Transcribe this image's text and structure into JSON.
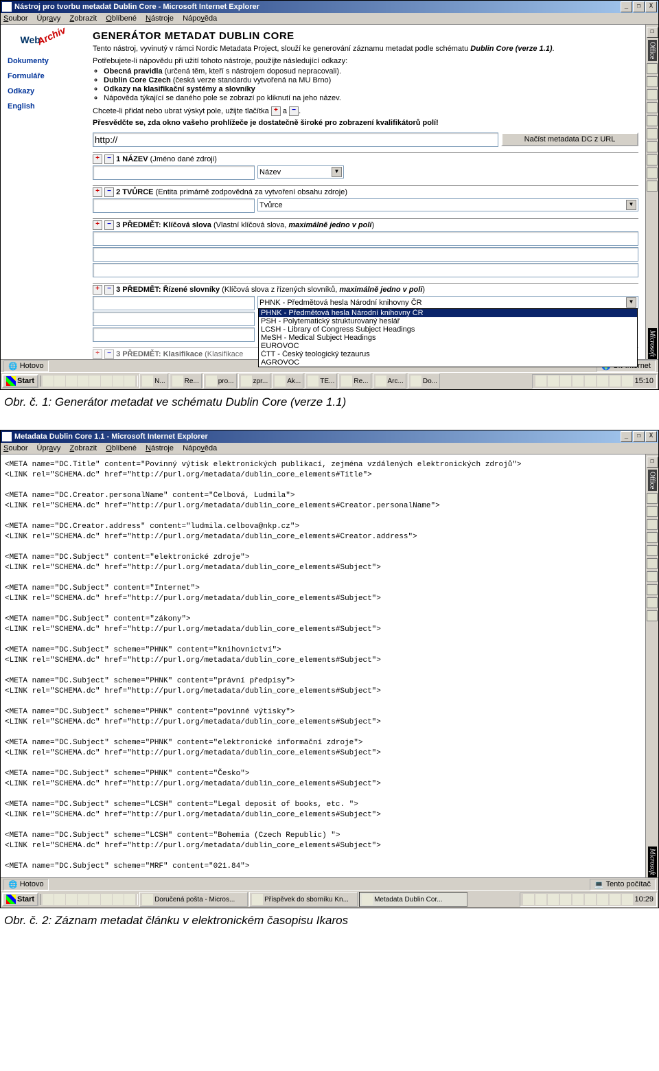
{
  "fig1": {
    "titlebar": "Nástroj pro tvorbu metadat Dublin Core - Microsoft Internet Explorer",
    "menus": [
      "Soubor",
      "Úpravy",
      "Zobrazit",
      "Oblíbené",
      "Nástroje",
      "Nápověda"
    ],
    "logo_web": "Web",
    "logo_archiv": "Archiv",
    "page_title": "GENERÁTOR METADAT DUBLIN CORE",
    "intro1": "Tento nástroj, vyvinutý v rámci Nordic Metadata Project, slouží ke generování záznamu metadat podle schématu ",
    "intro2_bold": "Dublin Core (verze 1.1)",
    "sidebar": [
      "Dokumenty",
      "Formuláře",
      "Odkazy",
      "English"
    ],
    "help_lead": "Potřebujete-li nápovědu při užití tohoto nástroje, použijte následující odkazy:",
    "help_items": [
      {
        "b": "Obecná pravidla",
        "t": " (určená těm, kteří s nástrojem doposud nepracovali)."
      },
      {
        "b": "Dublin Core Czech",
        "t": " (česká verze standardu vytvořená na MU Brno)"
      },
      {
        "b": "Odkazy na klasifikační systémy a slovníky",
        "t": ""
      },
      {
        "b": "",
        "t": "Nápověda týkající se daného pole se zobrazí po kliknutí na jeho název."
      }
    ],
    "buttons_note_1": "Chcete-li přidat nebo ubrat výskyt pole, užijte tlačítka ",
    "buttons_note_2": " a ",
    "bold_note": "Přesvědčte se, zda okno vašeho prohlížeče je dostatečně široké pro zobrazení kvalifikátorů polí!",
    "url_value": "http://",
    "load_btn": "Načíst metadata DC z URL",
    "field1_label": "1 NÁZEV",
    "field1_desc": " (Jméno dané zdroji)",
    "field1_sel": "Název",
    "field2_label": "2 TVŮRCE",
    "field2_desc": " (Entita primárně zodpovědná za vytvoření obsahu zdroje)",
    "field2_sel": "Tvůrce",
    "field3a_label": "3 PŘEDMĚT: Klíčová slova",
    "field3a_desc": " (Vlastní klíčová slova, ",
    "field3a_desc_i": "maximálně jedno v poli",
    "field3b_label": "3 PŘEDMĚT: Řízené slovníky",
    "field3b_desc": " (Klíčová slova z řízených slovníků, ",
    "field3b_desc_i": "maximálně jedno v poli",
    "field3b_sel": "PHNK - Předmětová hesla Národní knihovny ČR",
    "dd_items": [
      "PHNK - Předmětová hesla Národní knihovny ČR",
      "PSH - Polytematický strukturovaný heslář",
      "LCSH - Library of Congress Subject Headings",
      "MeSH - Medical Subject Headings",
      "EUROVOC",
      "ČTT - Český teologický tezaurus",
      "AGROVOC"
    ],
    "field3c_cut": "3 PŘEDMĚT: Klasifikace",
    "field3c_desc": " (Klasifikace ",
    "status_left": "Hotovo",
    "status_right": "Síť Internet",
    "start": "Start",
    "tasks": [
      "N...",
      "Re...",
      "pro...",
      "zpr...",
      "Ak...",
      "TE...",
      "Re...",
      "Arc...",
      "Do..."
    ],
    "clock": "15:10",
    "caption": "Obr. č. 1: Generátor metadat ve schématu Dublin Core (verze 1.1)"
  },
  "fig2": {
    "titlebar": "Metadata Dublin Core 1.1 - Microsoft Internet Explorer",
    "menus": [
      "Soubor",
      "Úpravy",
      "Zobrazit",
      "Oblíbené",
      "Nástroje",
      "Nápověda"
    ],
    "meta_lines": [
      "<META name=\"DC.Title\" content=\"Povinný výtisk elektronických publikací, zejména vzdálených elektronických zdrojů\">",
      "<LINK rel=\"SCHEMA.dc\" href=\"http://purl.org/metadata/dublin_core_elements#Title\">",
      "",
      "<META name=\"DC.Creator.personalName\" content=\"Celbová, Ludmila\">",
      "<LINK rel=\"SCHEMA.dc\" href=\"http://purl.org/metadata/dublin_core_elements#Creator.personalName\">",
      "",
      "<META name=\"DC.Creator.address\" content=\"ludmila.celbova@nkp.cz\">",
      "<LINK rel=\"SCHEMA.dc\" href=\"http://purl.org/metadata/dublin_core_elements#Creator.address\">",
      "",
      "<META name=\"DC.Subject\" content=\"elektronické zdroje\">",
      "<LINK rel=\"SCHEMA.dc\" href=\"http://purl.org/metadata/dublin_core_elements#Subject\">",
      "",
      "<META name=\"DC.Subject\" content=\"Internet\">",
      "<LINK rel=\"SCHEMA.dc\" href=\"http://purl.org/metadata/dublin_core_elements#Subject\">",
      "",
      "<META name=\"DC.Subject\" content=\"zákony\">",
      "<LINK rel=\"SCHEMA.dc\" href=\"http://purl.org/metadata/dublin_core_elements#Subject\">",
      "",
      "<META name=\"DC.Subject\" scheme=\"PHNK\" content=\"knihovnictví\">",
      "<LINK rel=\"SCHEMA.dc\" href=\"http://purl.org/metadata/dublin_core_elements#Subject\">",
      "",
      "<META name=\"DC.Subject\" scheme=\"PHNK\" content=\"právní předpisy\">",
      "<LINK rel=\"SCHEMA.dc\" href=\"http://purl.org/metadata/dublin_core_elements#Subject\">",
      "",
      "<META name=\"DC.Subject\" scheme=\"PHNK\" content=\"povinné výtisky\">",
      "<LINK rel=\"SCHEMA.dc\" href=\"http://purl.org/metadata/dublin_core_elements#Subject\">",
      "",
      "<META name=\"DC.Subject\" scheme=\"PHNK\" content=\"elektronické informační zdroje\">",
      "<LINK rel=\"SCHEMA.dc\" href=\"http://purl.org/metadata/dublin_core_elements#Subject\">",
      "",
      "<META name=\"DC.Subject\" scheme=\"PHNK\" content=\"Česko\">",
      "<LINK rel=\"SCHEMA.dc\" href=\"http://purl.org/metadata/dublin_core_elements#Subject\">",
      "",
      "<META name=\"DC.Subject\" scheme=\"LCSH\" content=\"Legal deposit of books, etc. \">",
      "<LINK rel=\"SCHEMA.dc\" href=\"http://purl.org/metadata/dublin_core_elements#Subject\">",
      "",
      "<META name=\"DC.Subject\" scheme=\"LCSH\" content=\"Bohemia (Czech Republic) \">",
      "<LINK rel=\"SCHEMA.dc\" href=\"http://purl.org/metadata/dublin_core_elements#Subject\">",
      "",
      "<META name=\"DC.Subject\" scheme=\"MRF\" content=\"021.84\">"
    ],
    "status_left": "Hotovo",
    "status_right": "Tento počítač",
    "start": "Start",
    "tasks": [
      "Doručená pošta - Micros...",
      "Příspěvek do sborníku Kn...",
      "Metadata Dublin Cor..."
    ],
    "clock": "10:29",
    "caption": "Obr. č. 2: Záznam metadat článku v elektronickém časopisu Ikaros"
  }
}
